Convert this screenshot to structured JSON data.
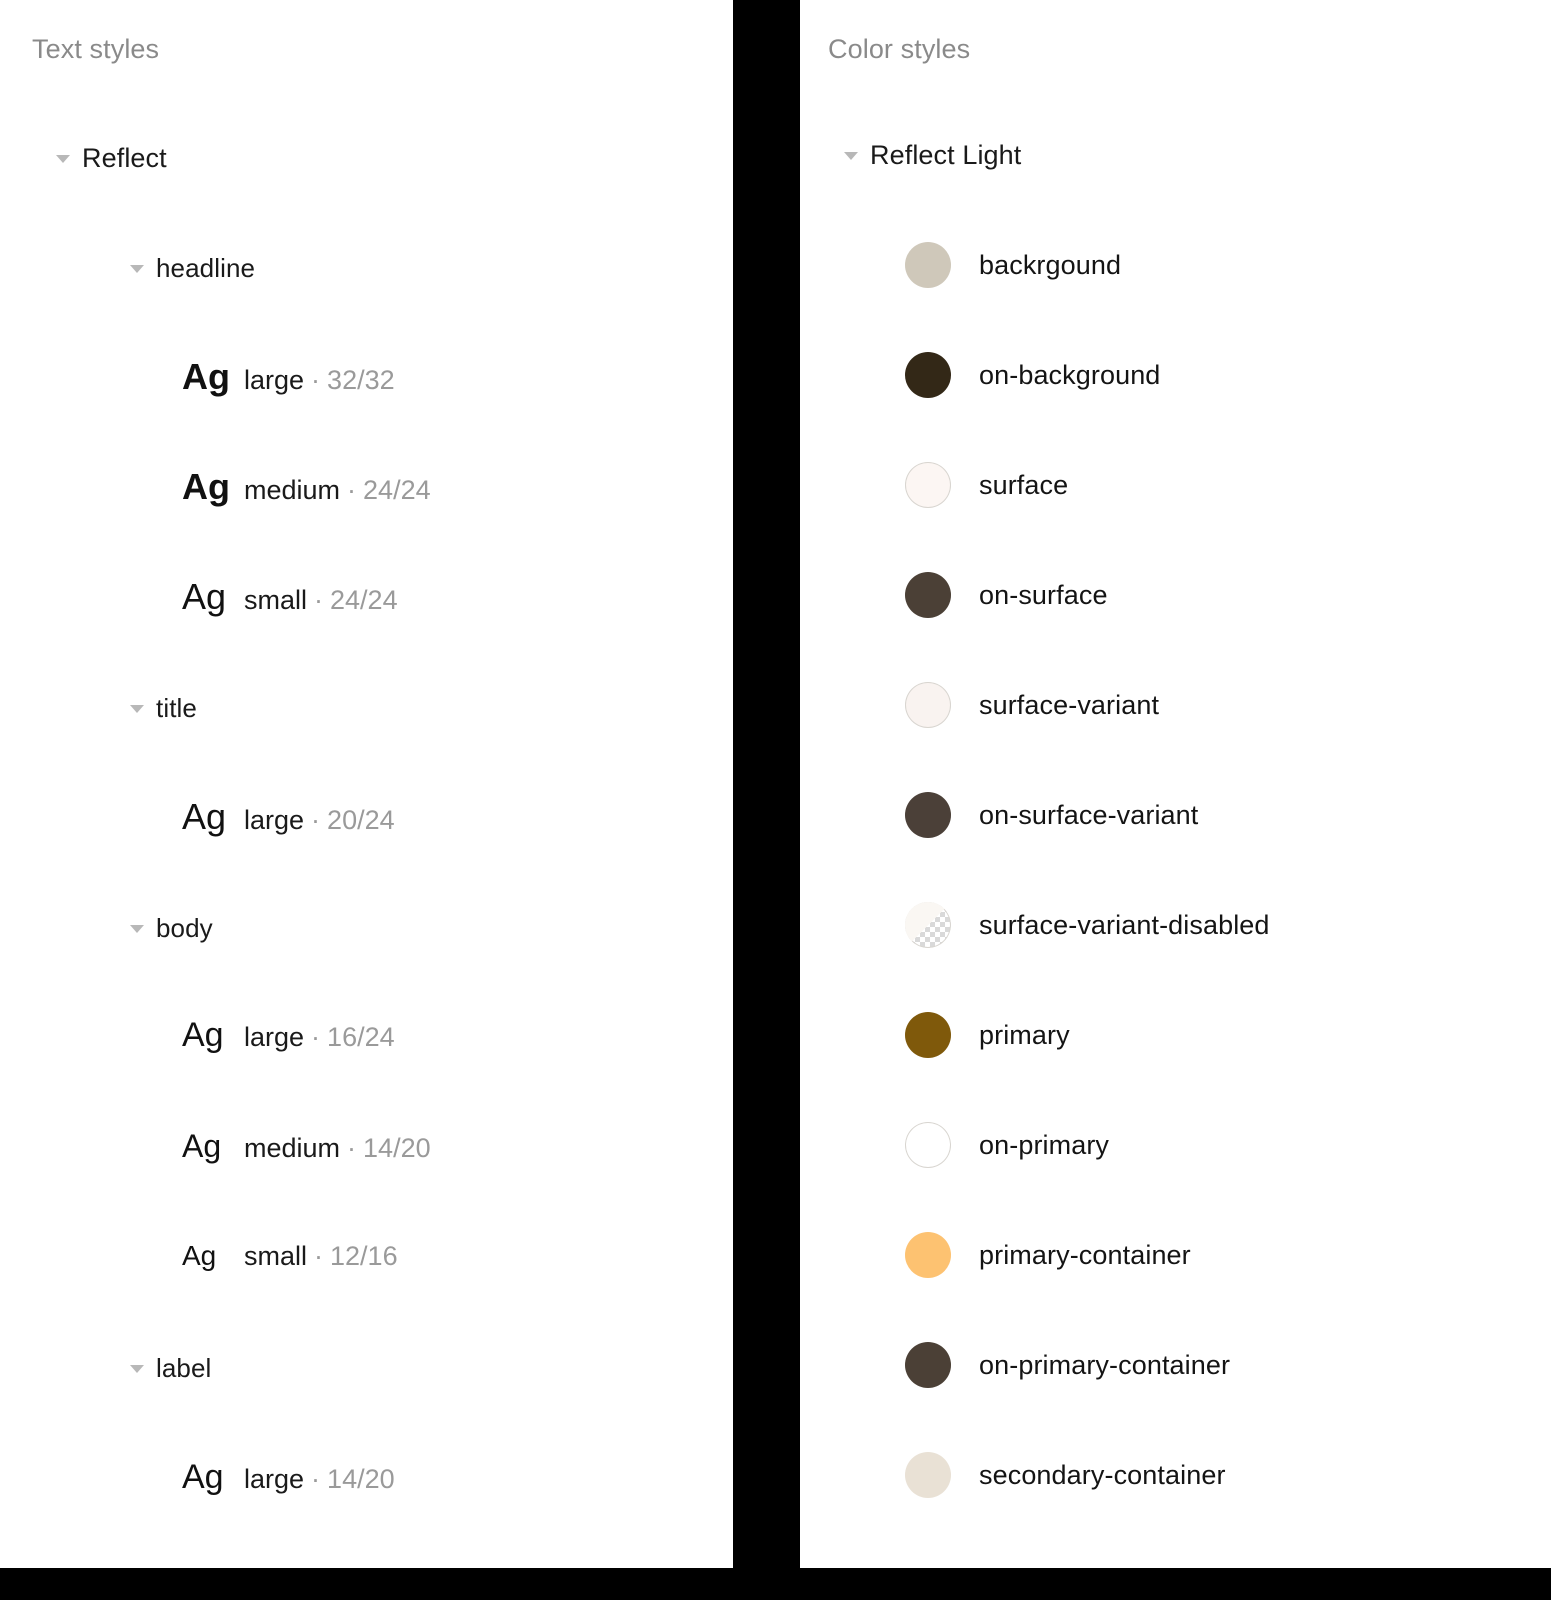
{
  "text_styles": {
    "title": "Text styles",
    "separator": "·",
    "tree": [
      {
        "label": "Reflect",
        "expanded": true,
        "groups": [
          {
            "label": "headline",
            "expanded": true,
            "styles": [
              {
                "specimen": "Ag",
                "name": "large",
                "metrics": "32/32"
              },
              {
                "specimen": "Ag",
                "name": "medium",
                "metrics": "24/24"
              },
              {
                "specimen": "Ag",
                "name": "small",
                "metrics": "24/24"
              }
            ]
          },
          {
            "label": "title",
            "expanded": true,
            "styles": [
              {
                "specimen": "Ag",
                "name": "large",
                "metrics": "20/24"
              }
            ]
          },
          {
            "label": "body",
            "expanded": true,
            "styles": [
              {
                "specimen": "Ag",
                "name": "large",
                "metrics": "16/24"
              },
              {
                "specimen": "Ag",
                "name": "medium",
                "metrics": "14/20"
              },
              {
                "specimen": "Ag",
                "name": "small",
                "metrics": "12/16"
              }
            ]
          },
          {
            "label": "label",
            "expanded": true,
            "styles": [
              {
                "specimen": "Ag",
                "name": "large",
                "metrics": "14/20"
              }
            ]
          }
        ]
      }
    ]
  },
  "color_styles": {
    "title": "Color styles",
    "groups": [
      {
        "label": "Reflect Light",
        "expanded": true,
        "colors": [
          {
            "name": "backrgound",
            "hex": "#CFC8BA"
          },
          {
            "name": "on-background",
            "hex": "#332817"
          },
          {
            "name": "surface",
            "hex": "#FCF6F3"
          },
          {
            "name": "on-surface",
            "hex": "#4B4036"
          },
          {
            "name": "surface-variant",
            "hex": "#F9F3F0"
          },
          {
            "name": "on-surface-variant",
            "hex": "#4B4038"
          },
          {
            "name": "surface-variant-disabled",
            "hex": "#FAF6F3"
          },
          {
            "name": "primary",
            "hex": "#7F590B"
          },
          {
            "name": "on-primary",
            "hex": "#FFFFFF"
          },
          {
            "name": "primary-container",
            "hex": "#FDC271"
          },
          {
            "name": "on-primary-container",
            "hex": "#4B4036"
          },
          {
            "name": "secondary-container",
            "hex": "#E9E1D5"
          }
        ]
      }
    ]
  }
}
